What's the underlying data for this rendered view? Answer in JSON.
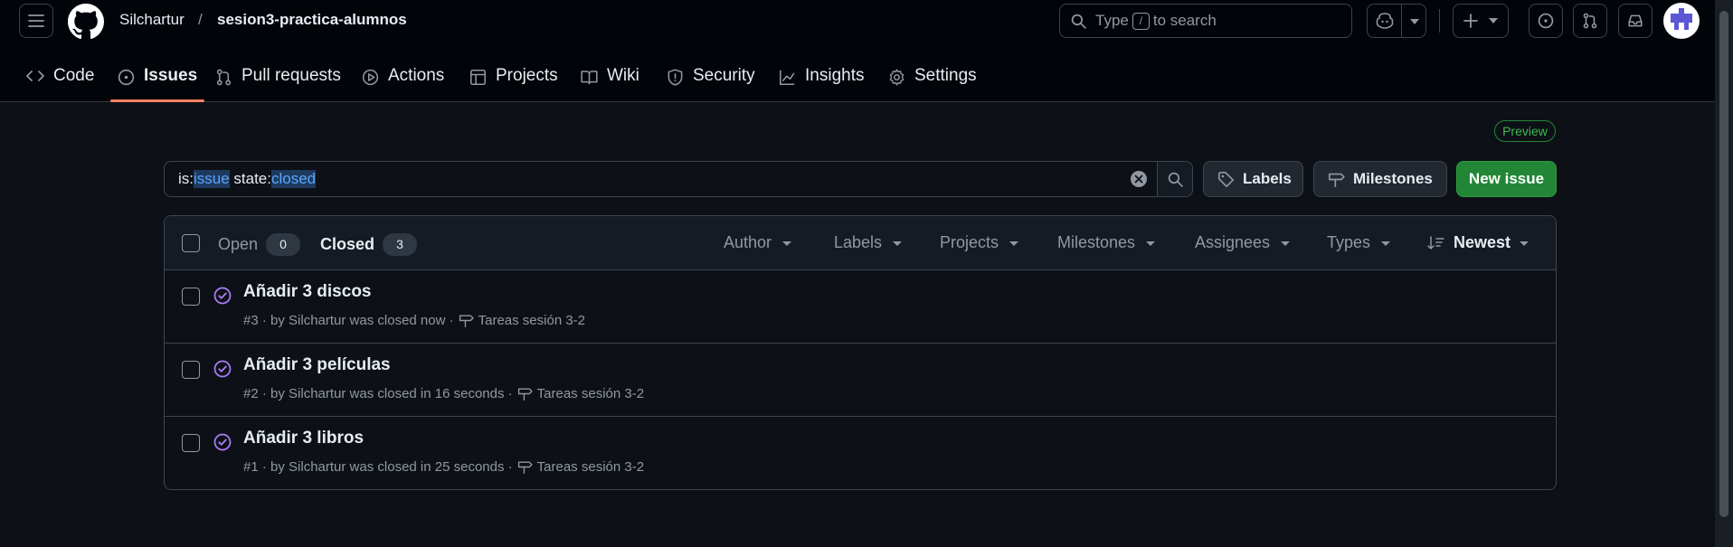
{
  "header": {
    "owner": "Silchartur",
    "separator": "/",
    "repo": "sesion3-practica-alumnos",
    "search_prefix": "Type",
    "search_key": "/",
    "search_suffix": "to search"
  },
  "tabs": [
    {
      "label": "Code",
      "icon": "code-icon"
    },
    {
      "label": "Issues",
      "icon": "issue-opened-icon",
      "active": true
    },
    {
      "label": "Pull requests",
      "icon": "git-pull-request-icon"
    },
    {
      "label": "Actions",
      "icon": "play-icon"
    },
    {
      "label": "Projects",
      "icon": "table-icon"
    },
    {
      "label": "Wiki",
      "icon": "book-icon"
    },
    {
      "label": "Security",
      "icon": "shield-icon"
    },
    {
      "label": "Insights",
      "icon": "graph-icon"
    },
    {
      "label": "Settings",
      "icon": "gear-icon"
    }
  ],
  "preview_badge": "Preview",
  "filter": {
    "parts": [
      "is:",
      "issue",
      " state:",
      "closed"
    ]
  },
  "buttons": {
    "labels": "Labels",
    "milestones": "Milestones",
    "new_issue": "New issue"
  },
  "list_header": {
    "open_label": "Open",
    "open_count": "0",
    "closed_label": "Closed",
    "closed_count": "3",
    "filters": [
      "Author",
      "Labels",
      "Projects",
      "Milestones",
      "Assignees",
      "Types"
    ],
    "sort_label": "Newest"
  },
  "issues": [
    {
      "title": "Añadir 3 discos",
      "meta": "#3 · by Silchartur was closed now ·",
      "milestone": "Tareas sesión 3-2"
    },
    {
      "title": "Añadir 3 películas",
      "meta": "#2 · by Silchartur was closed in 16 seconds ·",
      "milestone": "Tareas sesión 3-2"
    },
    {
      "title": "Añadir 3 libros",
      "meta": "#1 · by Silchartur was closed in 25 seconds ·",
      "milestone": "Tareas sesión 3-2"
    }
  ],
  "colors": {
    "background": "#0d1117",
    "header_bg": "#010409",
    "accent_tab": "#f78166",
    "closed_issue": "#ab7df8",
    "primary_button": "#238636",
    "link": "#58a6ff"
  }
}
